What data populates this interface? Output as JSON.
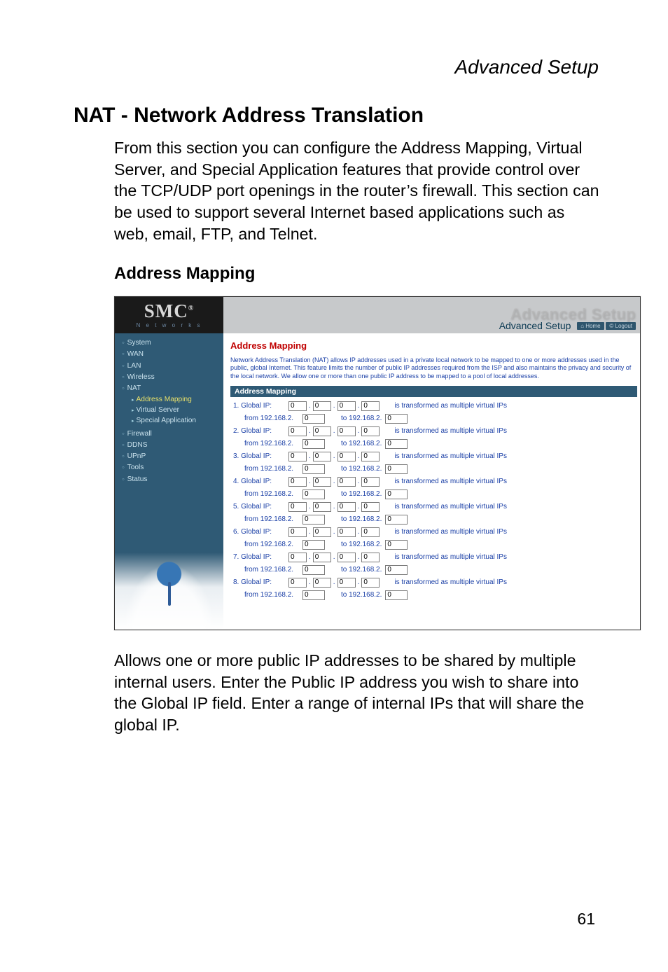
{
  "breadcrumb": "Advanced Setup",
  "section_title": "NAT - Network Address Translation",
  "intro_paragraph": "From this section you can configure the Address Mapping, Virtual Server, and Special Application features that provide control over the TCP/UDP port openings in the router’s firewall. This section can be used to support several Internet based applications such as web, email, FTP, and Telnet.",
  "subheading": "Address Mapping",
  "post_paragraph": "Allows one or more public IP addresses to be shared by multiple internal users. Enter the Public IP address you wish to share into the Global IP field. Enter a range of internal IPs that will share the global IP.",
  "page_number": "61",
  "screenshot": {
    "logo": {
      "text": "SMC",
      "reg": "®",
      "sub": "N e t w o r k s"
    },
    "header": {
      "watermark": "Advanced Setup",
      "title": "Advanced Setup",
      "links": {
        "home": "⌂ Home",
        "logout": "© Logout"
      }
    },
    "sidebar": {
      "items": [
        {
          "label": "System",
          "sub": []
        },
        {
          "label": "WAN",
          "sub": []
        },
        {
          "label": "LAN",
          "sub": []
        },
        {
          "label": "Wireless",
          "sub": []
        },
        {
          "label": "NAT",
          "sub": [
            {
              "label": "Address Mapping",
              "active": true
            },
            {
              "label": "Virtual Server",
              "active": false
            },
            {
              "label": "Special Application",
              "active": false
            }
          ]
        },
        {
          "label": "Firewall",
          "sub": []
        },
        {
          "label": "DDNS",
          "sub": []
        },
        {
          "label": "UPnP",
          "sub": []
        },
        {
          "label": "Tools",
          "sub": []
        },
        {
          "label": "Status",
          "sub": []
        }
      ]
    },
    "main": {
      "title": "Address Mapping",
      "intro": "Network Address Translation (NAT) allows IP addresses used in a private local network to be mapped to one or more addresses used in the public, global Internet. This feature limits the number of public IP addresses required from the ISP and also maintains the privacy and security of the local network. We allow one or more than one public IP address to be mapped to a pool of local addresses.",
      "section_bar": "Address Mapping",
      "rows": [
        {
          "idx": "1",
          "global": [
            "0",
            "0",
            "0",
            "0"
          ],
          "from": "0",
          "to": "0"
        },
        {
          "idx": "2",
          "global": [
            "0",
            "0",
            "0",
            "0"
          ],
          "from": "0",
          "to": "0"
        },
        {
          "idx": "3",
          "global": [
            "0",
            "0",
            "0",
            "0"
          ],
          "from": "0",
          "to": "0"
        },
        {
          "idx": "4",
          "global": [
            "0",
            "0",
            "0",
            "0"
          ],
          "from": "0",
          "to": "0"
        },
        {
          "idx": "5",
          "global": [
            "0",
            "0",
            "0",
            "0"
          ],
          "from": "0",
          "to": "0"
        },
        {
          "idx": "6",
          "global": [
            "0",
            "0",
            "0",
            "0"
          ],
          "from": "0",
          "to": "0"
        },
        {
          "idx": "7",
          "global": [
            "0",
            "0",
            "0",
            "0"
          ],
          "from": "0",
          "to": "0"
        },
        {
          "idx": "8",
          "global": [
            "0",
            "0",
            "0",
            "0"
          ],
          "from": "0",
          "to": "0"
        }
      ],
      "labels": {
        "global_prefix": "Global IP:",
        "from_prefix": "from  192.168.2.",
        "to_prefix": "to 192.168.2.",
        "tail": "is transformed as multiple virtual IPs"
      }
    }
  }
}
